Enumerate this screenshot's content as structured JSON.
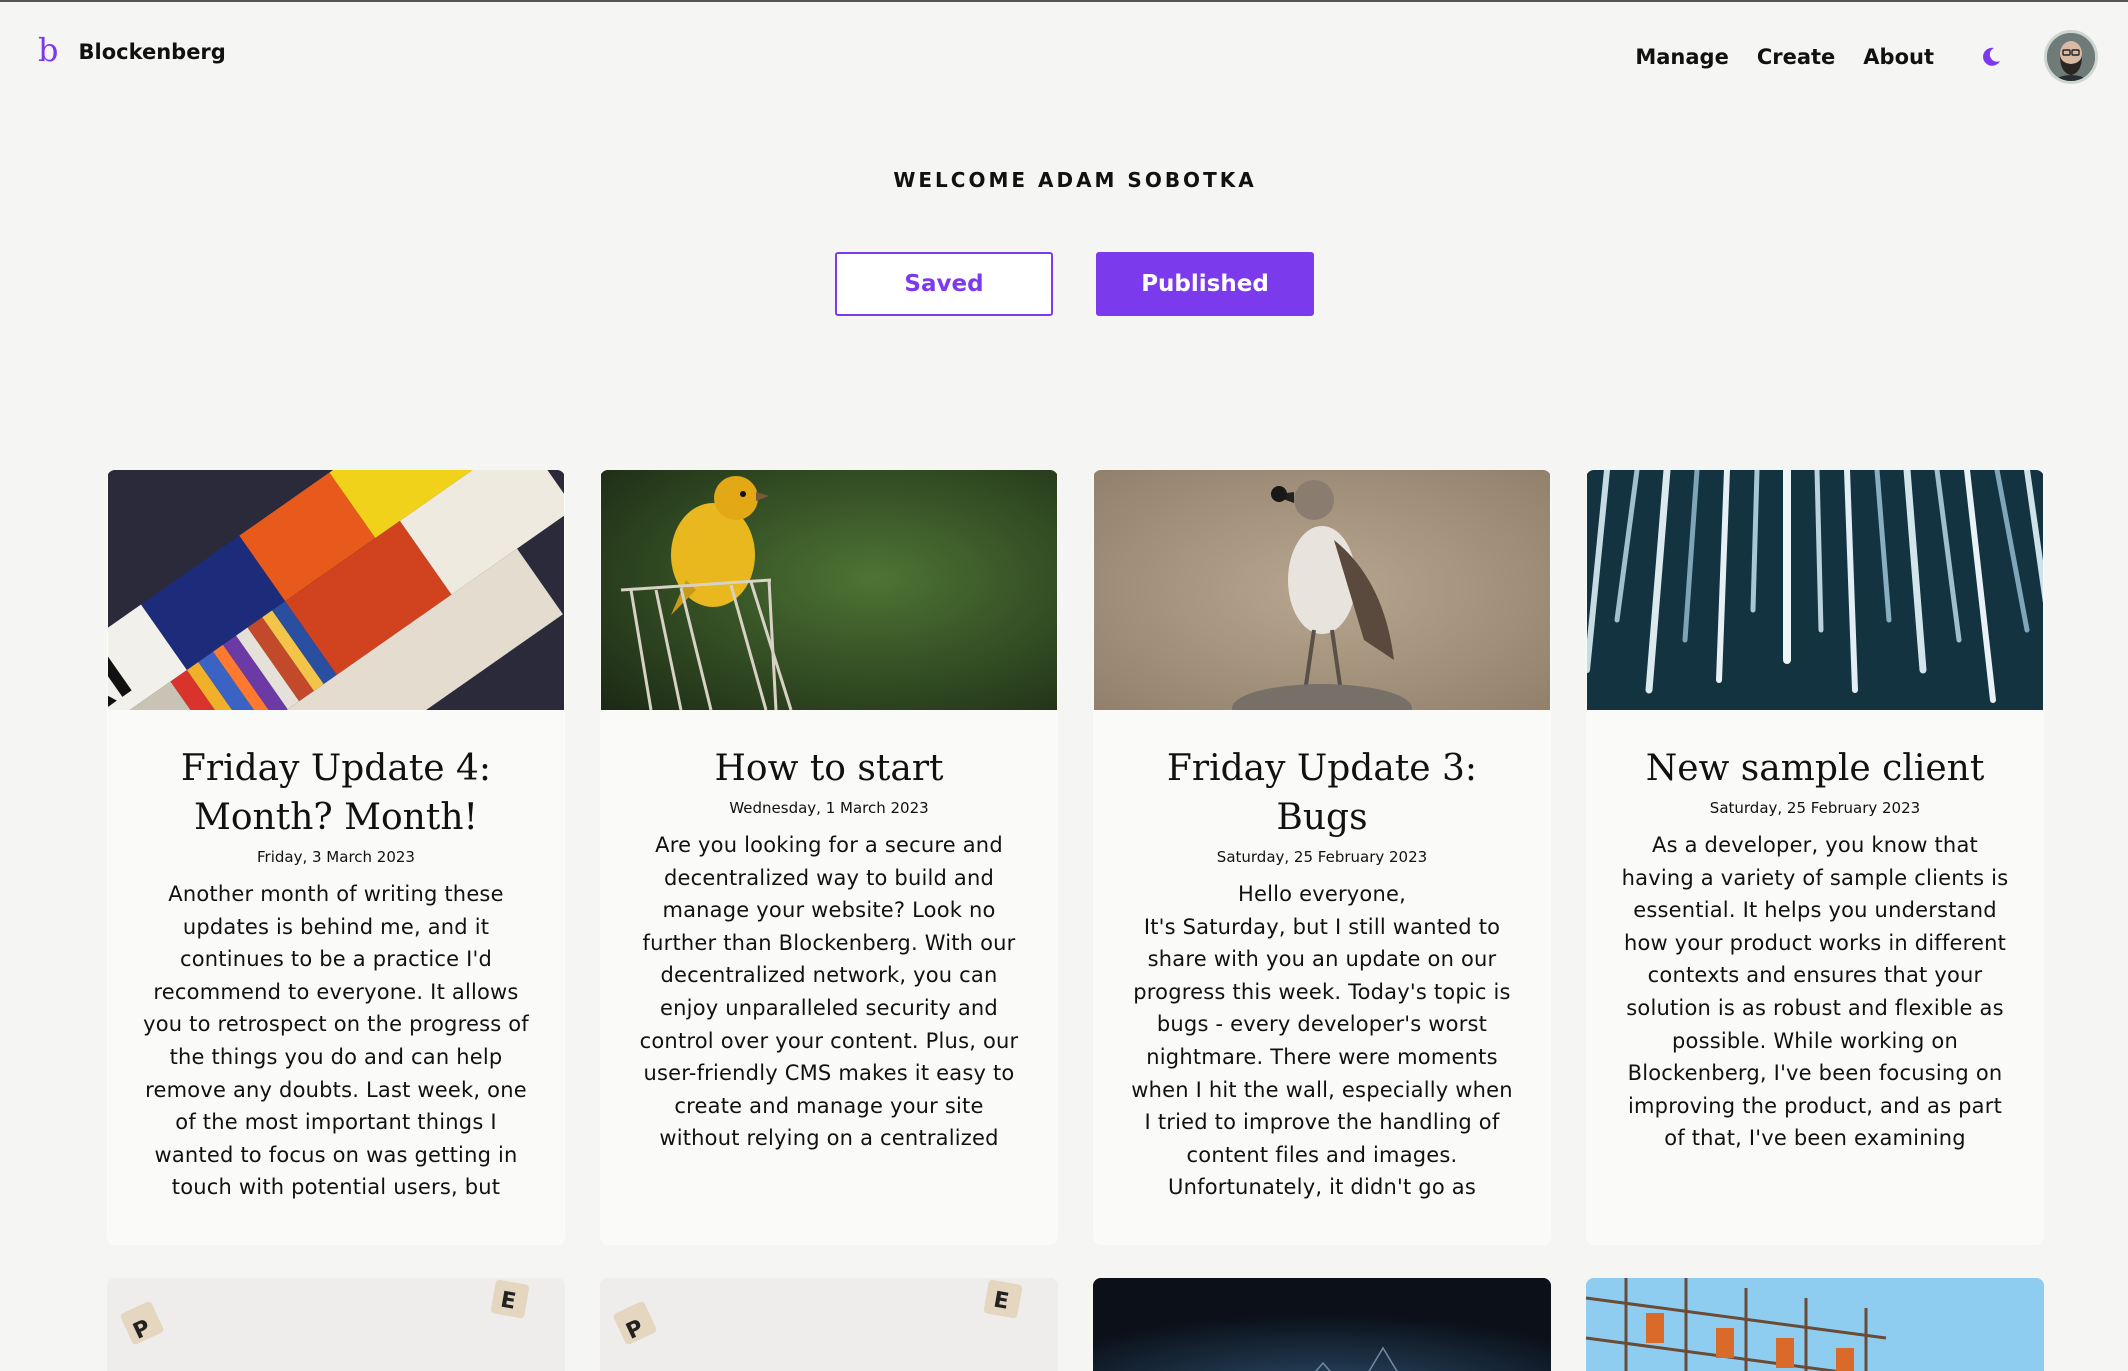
{
  "header": {
    "logo_mark": "b",
    "site_name": "Blockenberg",
    "nav": [
      "Manage",
      "Create",
      "About"
    ],
    "theme_icon": "moon-icon",
    "avatar_icon": "user-avatar"
  },
  "welcome": "WELCOME ADAM SOBOTKA",
  "tabs": {
    "saved": "Saved",
    "published": "Published"
  },
  "accent": "#7c3aed",
  "posts": [
    {
      "title": "Friday Update 4: Month? Month!",
      "date": "Friday, 3 March 2023",
      "excerpt": "Another month of writing these updates is behind me, and it continues to be a practice I'd recommend to everyone. It allows you to retrospect on the progress of the things you do and can help remove any doubts. Last week, one of the most important things I wanted to focus on was getting in touch with potential users, but"
    },
    {
      "title": "How to start",
      "date": "Wednesday, 1 March 2023",
      "excerpt": "Are you looking for a secure and decentralized way to build and manage your website? Look no further than Blockenberg. With our decentralized network, you can enjoy unparalleled security and control over your content. Plus, our user-friendly CMS makes it easy to create and manage your site without relying on a centralized"
    },
    {
      "title": "Friday Update 3: Bugs",
      "date": "Saturday, 25 February 2023",
      "excerpt": "Hello everyone,\nIt's Saturday, but I still wanted to share with you an update on our progress this week. Today's topic is bugs - every developer's worst nightmare. There were moments when I hit the wall, especially when I tried to improve the handling of content files and images. Unfortunately, it didn't go as"
    },
    {
      "title": "New sample client",
      "date": "Saturday, 25 February 2023",
      "excerpt": "As a developer, you know that having a variety of sample clients is essential. It helps you understand how your product works in different contexts and ensures that your solution is as robust and flexible as possible. While working on Blockenberg, I've been focusing on improving the product, and as part of that, I've been examining"
    }
  ]
}
